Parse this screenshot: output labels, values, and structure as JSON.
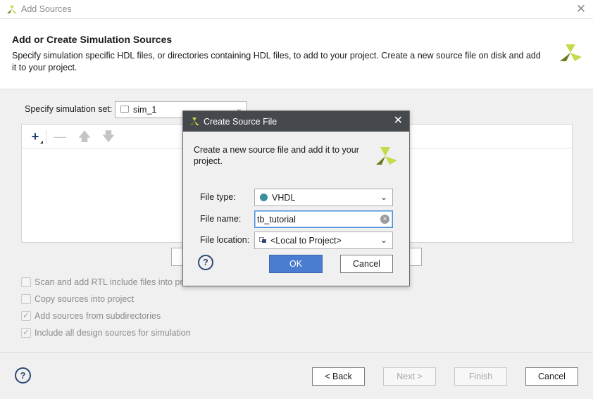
{
  "window": {
    "title": "Add Sources",
    "close_glyph": "✕"
  },
  "header": {
    "title": "Add or Create Simulation Sources",
    "description": "Specify simulation specific HDL files, or directories containing HDL files, to add to your project. Create a new source file on disk and add it to your project."
  },
  "simulation_set": {
    "label": "Specify simulation set:",
    "value": "sim_1"
  },
  "toolbar": {
    "add_glyph": "+",
    "remove_glyph": "—",
    "up_glyph": "🡅",
    "down_glyph": "🡇"
  },
  "options": [
    {
      "label": "Scan and add RTL include files into project",
      "checked": false
    },
    {
      "label": "Copy sources into project",
      "checked": false
    },
    {
      "label": "Add sources from subdirectories",
      "checked": true
    },
    {
      "label": "Include all design sources for simulation",
      "checked": true
    }
  ],
  "footer": {
    "help": "?",
    "back": "< Back",
    "next": "Next >",
    "finish": "Finish",
    "cancel": "Cancel"
  },
  "dialog": {
    "title": "Create Source File",
    "close_glyph": "✕",
    "description": "Create a new source file and add it to your project.",
    "file_type_label": "File type:",
    "file_type_value": "VHDL",
    "file_name_label": "File name:",
    "file_name_value": "tb_tutorial",
    "file_location_label": "File location:",
    "file_location_value": "<Local to Project>",
    "help": "?",
    "ok": "OK",
    "cancel": "Cancel"
  },
  "colors": {
    "accent_blue": "#4a7ccf",
    "dialog_titlebar": "#45484c",
    "vhdl_dot": "#3a8ea0",
    "logo_light": "#c8d94a",
    "logo_dark": "#6e7a1f"
  },
  "icons": {
    "app": "xilinx-logo-icon",
    "folder": "folder-icon",
    "add": "plus-icon",
    "remove": "minus-icon",
    "up": "arrow-up-icon",
    "down": "arrow-down-icon",
    "clear": "clear-icon",
    "help": "help-icon"
  }
}
